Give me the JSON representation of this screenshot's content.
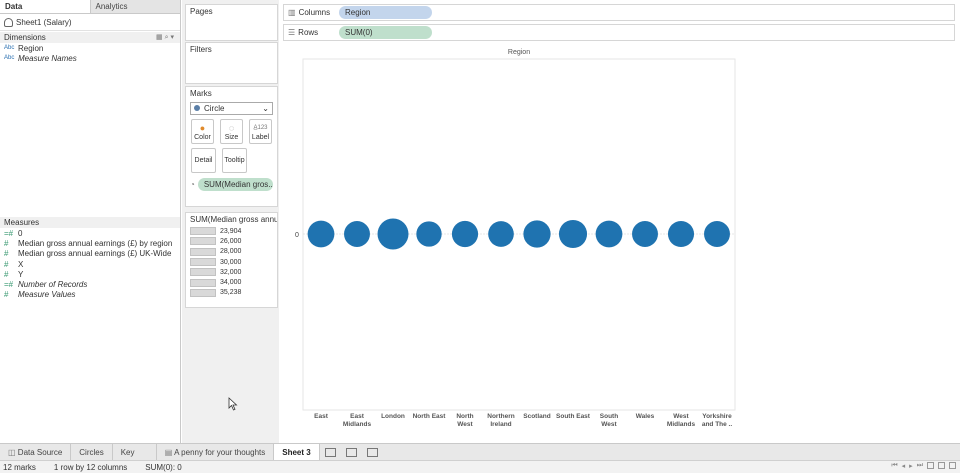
{
  "data_pane": {
    "tabs": [
      {
        "label": "Data"
      },
      {
        "label": "Analytics"
      }
    ],
    "datasource": "Sheet1 (Salary)",
    "dimensions_header": "Dimensions",
    "dimensions": [
      {
        "type": "Abc",
        "label": "Region",
        "italic": false
      },
      {
        "type": "Abc",
        "label": "Measure Names",
        "italic": true
      }
    ],
    "measures_header": "Measures",
    "measures": [
      {
        "type": "=#",
        "label": "0",
        "italic": false
      },
      {
        "type": "#",
        "label": "Median gross annual earnings (£) by region",
        "italic": false
      },
      {
        "type": "#",
        "label": "Median gross annual earnings (£) UK-Wide",
        "italic": false
      },
      {
        "type": "#",
        "label": "X",
        "italic": false
      },
      {
        "type": "#",
        "label": "Y",
        "italic": false
      },
      {
        "type": "=#",
        "label": "Number of Records",
        "italic": true
      },
      {
        "type": "#",
        "label": "Measure Values",
        "italic": true
      }
    ]
  },
  "cards": {
    "pages": "Pages",
    "filters": "Filters",
    "marks": {
      "title": "Marks",
      "mark_type": "Circle",
      "buttons": [
        {
          "label": "Color",
          "icon": "color-icon"
        },
        {
          "label": "Size",
          "icon": "size-icon"
        },
        {
          "label": "Label",
          "icon": "label-icon"
        },
        {
          "label": "Detail",
          "icon": ""
        },
        {
          "label": "Tooltip",
          "icon": ""
        }
      ],
      "size_pill": "SUM(Median gros.."
    },
    "legend": {
      "title": "SUM(Median gross annu...",
      "values": [
        "23,904",
        "26,000",
        "28,000",
        "30,000",
        "32,000",
        "34,000",
        "35,238"
      ]
    }
  },
  "shelves": {
    "columns_label": "Columns",
    "columns_pill": "Region",
    "rows_label": "Rows",
    "rows_pill": "SUM(0)"
  },
  "chart_data": {
    "type": "scatter",
    "title": "",
    "header": "Region",
    "axis_label": "0",
    "categories": [
      "East",
      "East Midlands",
      "London",
      "North East",
      "North West",
      "Northern Ireland",
      "Scotland",
      "South East",
      "South West",
      "Wales",
      "West Midlands",
      "Yorkshire and The .."
    ],
    "category_lines": [
      [
        "East"
      ],
      [
        "East",
        "Midlands"
      ],
      [
        "London"
      ],
      [
        "North East"
      ],
      [
        "North",
        "West"
      ],
      [
        "Northern",
        "Ireland"
      ],
      [
        "Scotland"
      ],
      [
        "South East"
      ],
      [
        "South",
        "West"
      ],
      [
        "Wales"
      ],
      [
        "West",
        "Midlands"
      ],
      [
        "Yorkshire",
        "and The .."
      ]
    ],
    "y": [
      0,
      0,
      0,
      0,
      0,
      0,
      0,
      0,
      0,
      0,
      0,
      0
    ],
    "size_values": [
      27000,
      25500,
      35238,
      24500,
      26000,
      25000,
      27800,
      29500,
      27000,
      25500,
      25800,
      25500
    ],
    "size_range": [
      23904,
      35238
    ],
    "mark_color": "#1f73b0"
  },
  "bottom_tabs": [
    {
      "label": "Data Source",
      "active": false
    },
    {
      "label": "Circles",
      "active": false
    },
    {
      "label": "Key",
      "active": false
    },
    {
      "label": "A penny for your thoughts",
      "active": false
    },
    {
      "label": "Sheet 3",
      "active": true
    }
  ],
  "status": {
    "marks": "12 marks",
    "rows_cols": "1 row by 12 columns",
    "sum": "SUM(0): 0"
  }
}
